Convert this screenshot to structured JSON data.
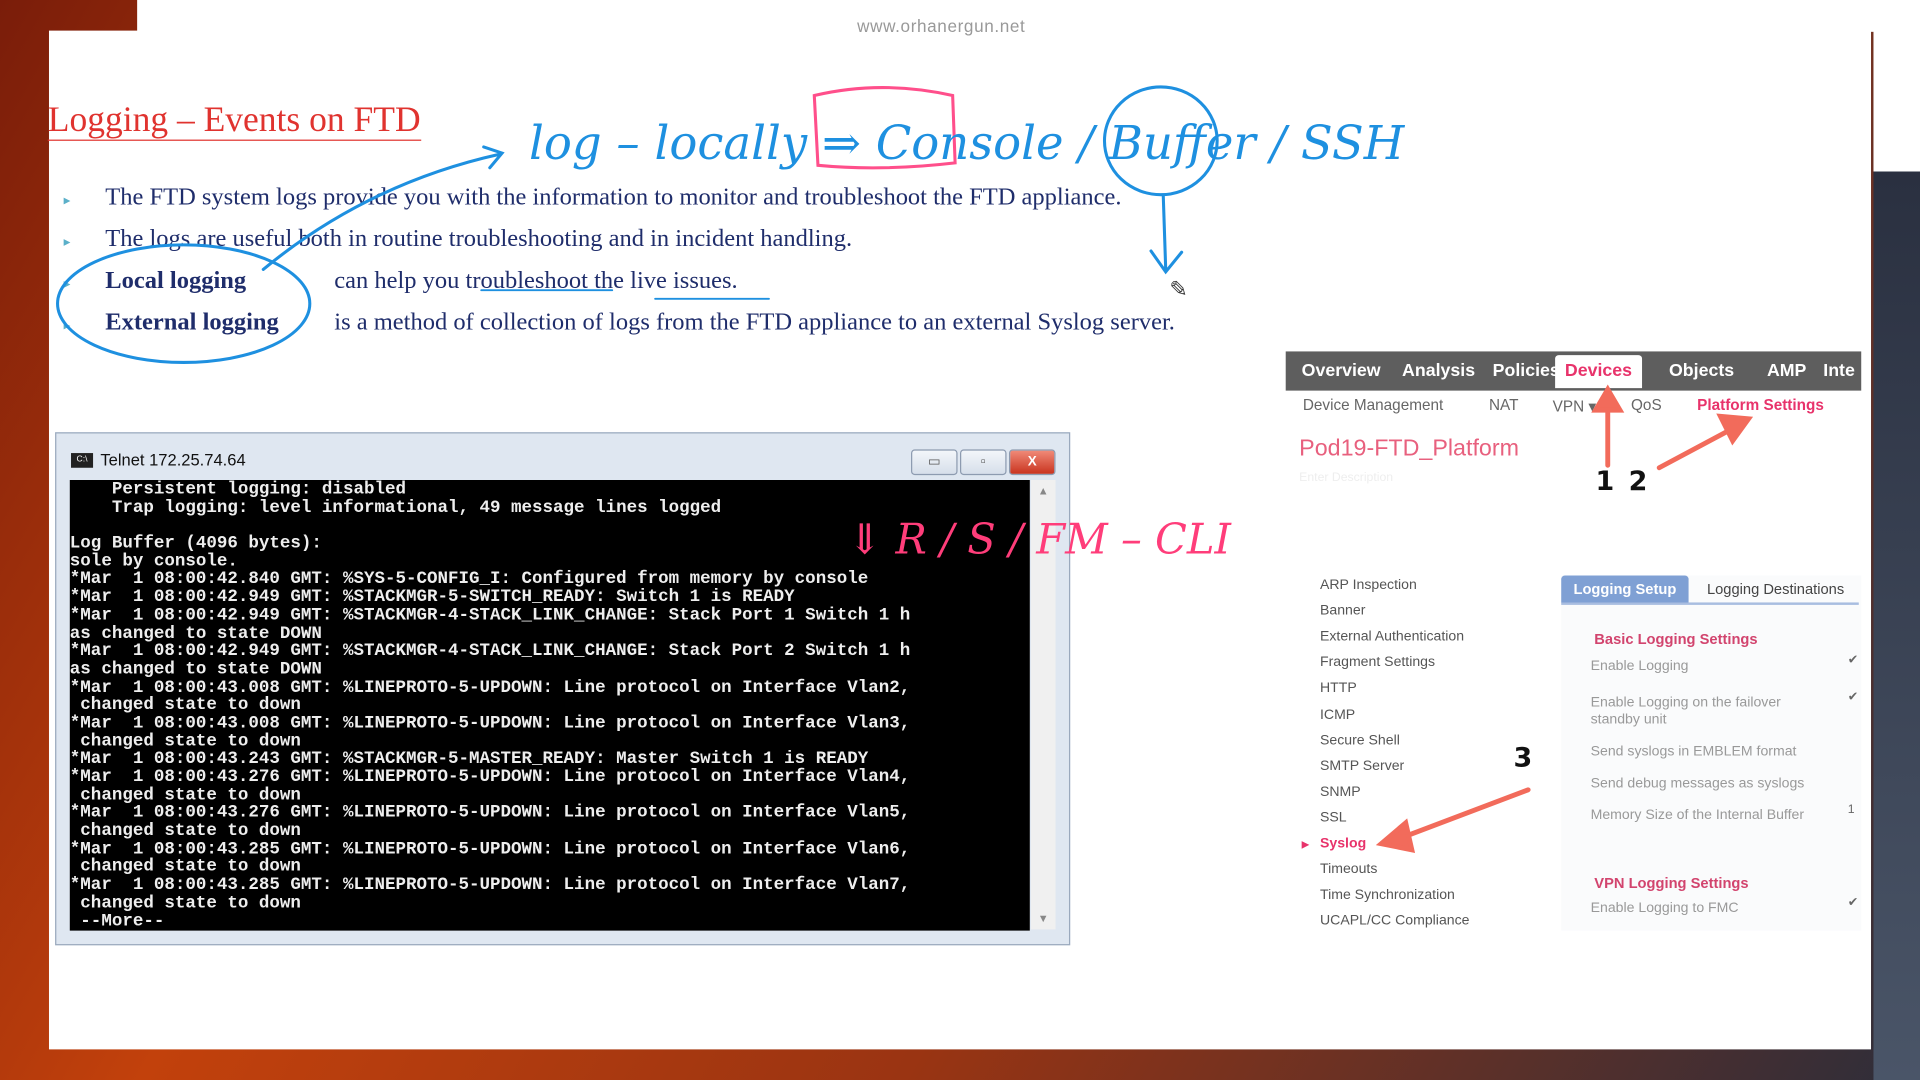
{
  "website": "www.orhanergun.net",
  "slide": {
    "title": "Logging – Events on FTD",
    "bullets": [
      {
        "text": "The FTD system logs provide you with the information to monitor and troubleshoot the FTD appliance."
      },
      {
        "text": "The logs are useful both in routine troubleshooting and in incident handling."
      },
      {
        "label": "Local logging",
        "text": "can help you troubleshoot the live issues."
      },
      {
        "label": "External logging",
        "text": "is a method of collection of logs from the FTD appliance to an external Syslog server."
      }
    ],
    "handwriting": {
      "top": "log – locally ⇒ Console / Buffer / SSH",
      "terminal": "⇓ R / S / FM – CLI"
    }
  },
  "telnet": {
    "title": "Telnet 172.25.74.64",
    "icon_label": "C:\\",
    "buttons": {
      "minimize": "▭",
      "restore": "▫",
      "close": "X"
    },
    "lines": [
      "    Persistent logging: disabled",
      "    Trap logging: level informational, 49 message lines logged",
      "",
      "Log Buffer (4096 bytes):",
      "sole by console.",
      "*Mar  1 08:00:42.840 GMT: %SYS-5-CONFIG_I: Configured from memory by console",
      "*Mar  1 08:00:42.949 GMT: %STACKMGR-5-SWITCH_READY: Switch 1 is READY",
      "*Mar  1 08:00:42.949 GMT: %STACKMGR-4-STACK_LINK_CHANGE: Stack Port 1 Switch 1 h",
      "as changed to state DOWN",
      "*Mar  1 08:00:42.949 GMT: %STACKMGR-4-STACK_LINK_CHANGE: Stack Port 2 Switch 1 h",
      "as changed to state DOWN",
      "*Mar  1 08:00:43.008 GMT: %LINEPROTO-5-UPDOWN: Line protocol on Interface Vlan2,",
      " changed state to down",
      "*Mar  1 08:00:43.008 GMT: %LINEPROTO-5-UPDOWN: Line protocol on Interface Vlan3,",
      " changed state to down",
      "*Mar  1 08:00:43.243 GMT: %STACKMGR-5-MASTER_READY: Master Switch 1 is READY",
      "*Mar  1 08:00:43.276 GMT: %LINEPROTO-5-UPDOWN: Line protocol on Interface Vlan4,",
      " changed state to down",
      "*Mar  1 08:00:43.276 GMT: %LINEPROTO-5-UPDOWN: Line protocol on Interface Vlan5,",
      " changed state to down",
      "*Mar  1 08:00:43.285 GMT: %LINEPROTO-5-UPDOWN: Line protocol on Interface Vlan6,",
      " changed state to down",
      "*Mar  1 08:00:43.285 GMT: %LINEPROTO-5-UPDOWN: Line protocol on Interface Vlan7,",
      " changed state to down",
      " --More--"
    ]
  },
  "fmc": {
    "nav": [
      "Overview",
      "Analysis",
      "Policies",
      "Devices",
      "Objects",
      "AMP",
      "Inte"
    ],
    "active_nav": "Devices",
    "subnav": [
      "Device Management",
      "NAT",
      "VPN ▾",
      "QoS",
      "Platform Settings"
    ],
    "policy_name": "Pod19-FTD_Platform",
    "policy_description": "Enter Description",
    "sidebar": [
      "ARP Inspection",
      "Banner",
      "External Authentication",
      "Fragment Settings",
      "HTTP",
      "ICMP",
      "Secure Shell",
      "SMTP Server",
      "SNMP",
      "SSL",
      "Syslog",
      "Timeouts",
      "Time Synchronization",
      "UCAPL/CC Compliance"
    ],
    "selected_sidebar": "Syslog",
    "tabs": [
      "Logging Setup",
      "Logging Destinations"
    ],
    "basic_heading": "Basic Logging Settings",
    "basic_rows": [
      {
        "label": "Enable Logging",
        "value": "✔"
      },
      {
        "label": "Enable Logging on the failover standby unit",
        "value": "✔"
      },
      {
        "label": "Send syslogs in EMBLEM format",
        "value": ""
      },
      {
        "label": "Send debug messages as syslogs",
        "value": ""
      },
      {
        "label": "Memory Size of the Internal Buffer",
        "value": "1"
      }
    ],
    "vpn_heading": "VPN Logging Settings",
    "vpn_rows": [
      {
        "label": "Enable Logging to FMC",
        "value": "✔"
      }
    ],
    "accent": "#e8336b"
  },
  "annotations": {
    "step1": "1",
    "step2": "2",
    "step3": "3"
  },
  "colors": {
    "title": "#e0332f",
    "body_text": "#1f2d6b",
    "ink_blue": "#1e90e0",
    "ink_pink": "#ff3d7a",
    "arrow": "#f26b5b"
  }
}
